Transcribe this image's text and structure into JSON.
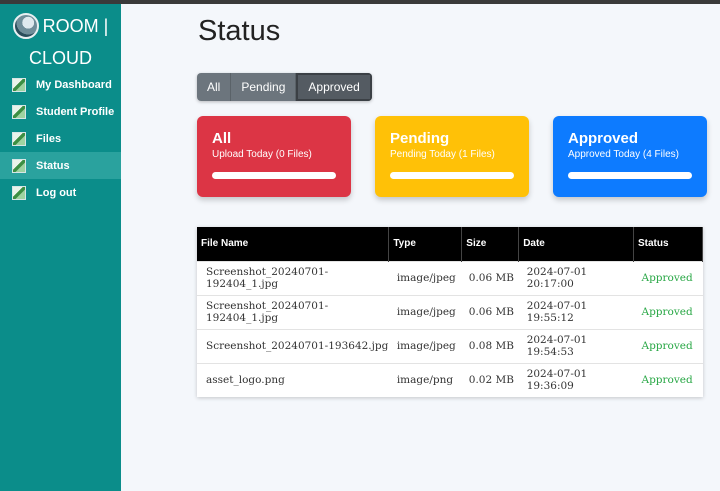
{
  "brand": {
    "line1": "ROOM |",
    "line2": "CLOUD"
  },
  "sidebar": {
    "items": [
      {
        "label": "My Dashboard",
        "icon": "image-icon"
      },
      {
        "label": "Student Profile",
        "icon": "image-icon"
      },
      {
        "label": "Files",
        "icon": "image-icon"
      },
      {
        "label": "Status",
        "icon": "image-icon",
        "active": true
      },
      {
        "label": "Log out",
        "icon": "image-icon"
      }
    ]
  },
  "page": {
    "title": "Status"
  },
  "filters": [
    {
      "label": "All"
    },
    {
      "label": "Pending"
    },
    {
      "label": "Approved",
      "active": true
    }
  ],
  "cards": [
    {
      "title": "All",
      "subtitle": "Upload Today (0 Files)",
      "color": "#dc3545"
    },
    {
      "title": "Pending",
      "subtitle": "Pending Today (1 Files)",
      "color": "#ffc107"
    },
    {
      "title": "Approved",
      "subtitle": "Approved Today (4 Files)",
      "color": "#0d7bff"
    }
  ],
  "table": {
    "headers": [
      "File Name",
      "Type",
      "Size",
      "Date",
      "Status"
    ],
    "rows": [
      [
        "Screenshot_20240701-192404_1.jpg",
        "image/jpeg",
        "0.06 MB",
        "2024-07-01 20:17:00",
        "Approved"
      ],
      [
        "Screenshot_20240701-192404_1.jpg",
        "image/jpeg",
        "0.06 MB",
        "2024-07-01 19:55:12",
        "Approved"
      ],
      [
        "Screenshot_20240701-193642.jpg",
        "image/jpeg",
        "0.08 MB",
        "2024-07-01 19:54:53",
        "Approved"
      ],
      [
        "asset_logo.png",
        "image/png",
        "0.02 MB",
        "2024-07-01 19:36:09",
        "Approved"
      ]
    ]
  }
}
